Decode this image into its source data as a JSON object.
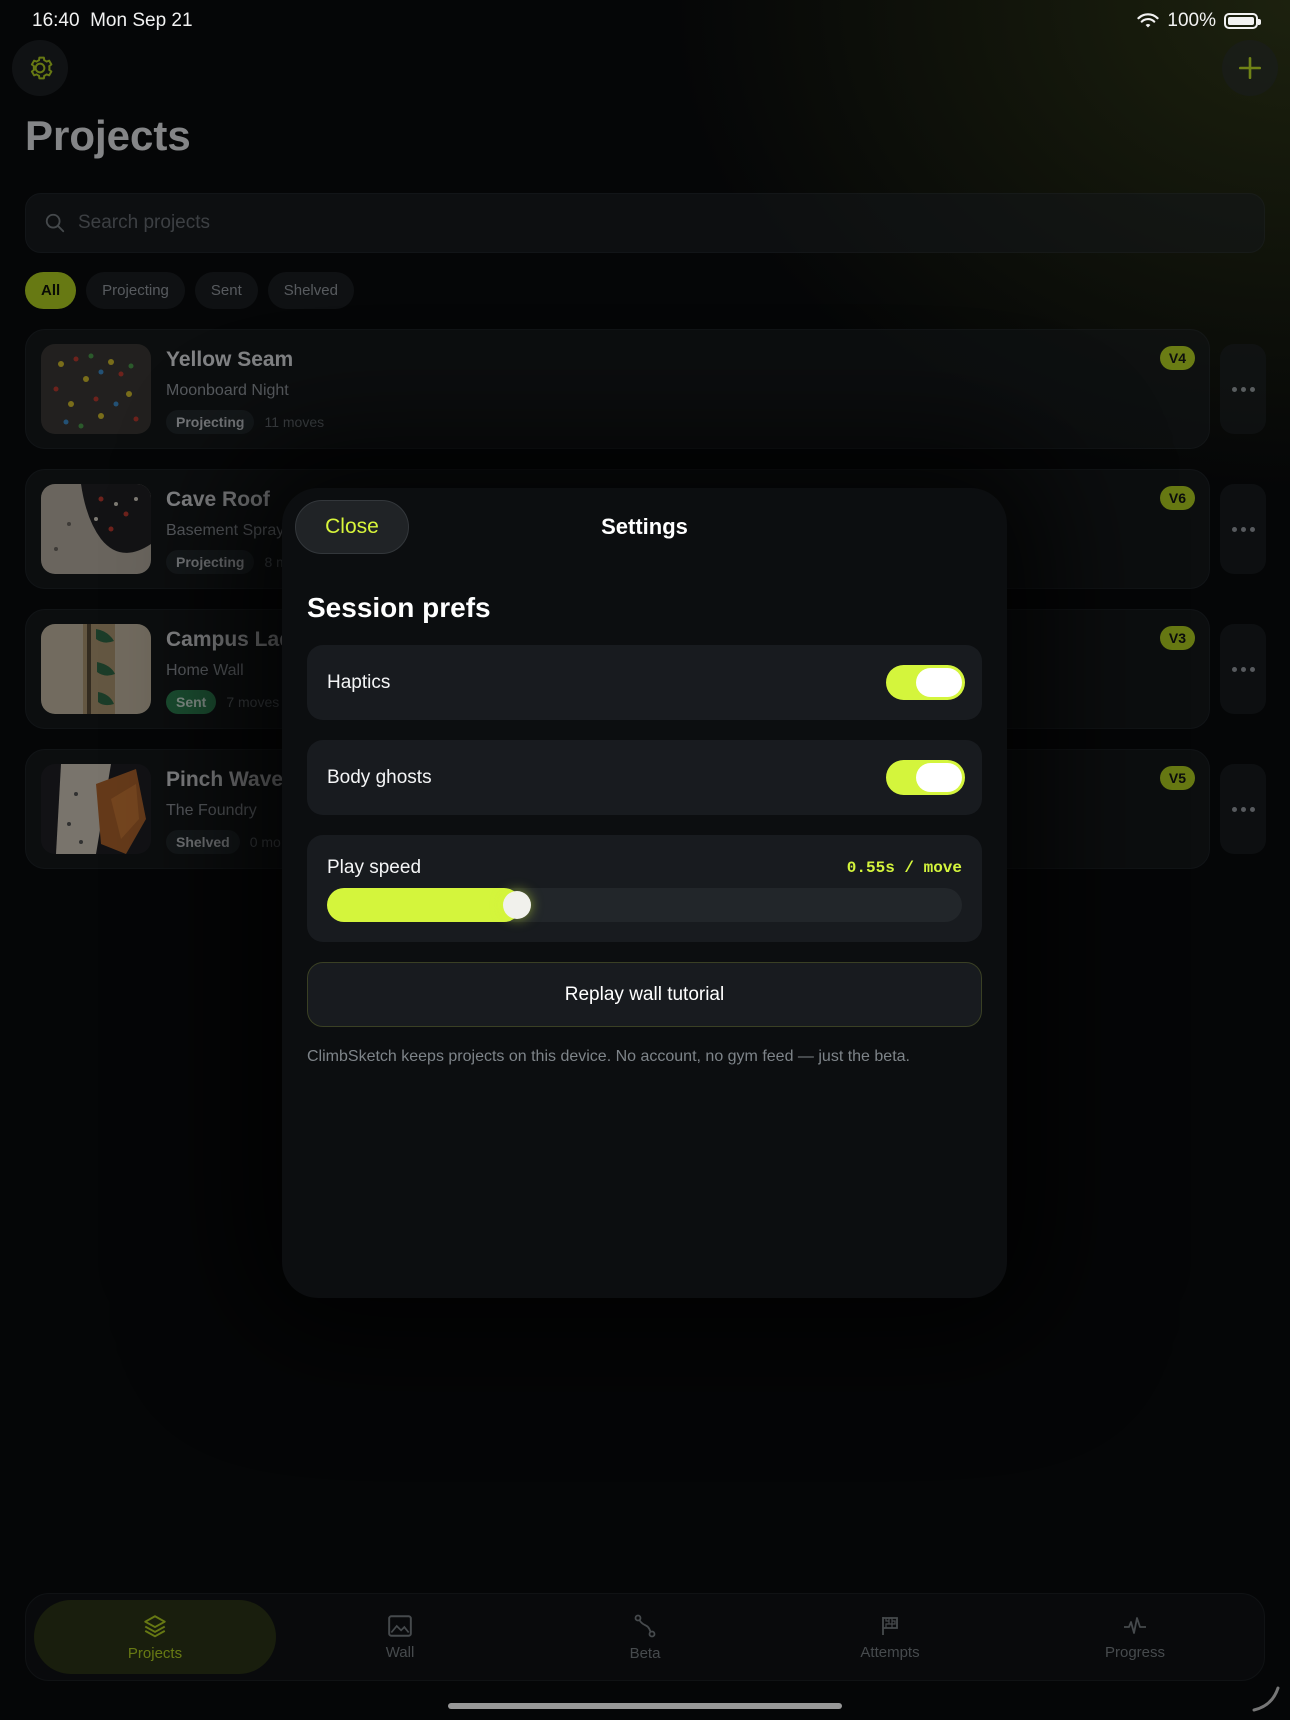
{
  "status_bar": {
    "time": "16:40",
    "date": "Mon Sep 21",
    "battery": "100%"
  },
  "header": {
    "title": "Projects",
    "settings_icon": "gear-icon",
    "add_icon": "plus-icon"
  },
  "search": {
    "placeholder": "Search projects"
  },
  "filters": [
    {
      "label": "All",
      "active": true
    },
    {
      "label": "Projecting",
      "active": false
    },
    {
      "label": "Sent",
      "active": false
    },
    {
      "label": "Shelved",
      "active": false
    }
  ],
  "projects": [
    {
      "name": "Yellow Seam",
      "location": "Moonboard Night",
      "status": "Projecting",
      "moves": "11 moves",
      "grade": "V4"
    },
    {
      "name": "Cave Roof",
      "location": "Basement Spray",
      "status": "Projecting",
      "moves": "8 m",
      "grade": "V6"
    },
    {
      "name": "Campus Lad",
      "location": "Home Wall",
      "status": "Sent",
      "moves": "7 moves",
      "grade": "V3"
    },
    {
      "name": "Pinch Wave",
      "location": "The Foundry",
      "status": "Shelved",
      "moves": "0 mo",
      "grade": "V5"
    }
  ],
  "tabbar": [
    {
      "label": "Projects",
      "icon": "layers-icon",
      "active": true
    },
    {
      "label": "Wall",
      "icon": "image-icon",
      "active": false
    },
    {
      "label": "Beta",
      "icon": "route-icon",
      "active": false
    },
    {
      "label": "Attempts",
      "icon": "flag-icon",
      "active": false
    },
    {
      "label": "Progress",
      "icon": "pulse-icon",
      "active": false
    }
  ],
  "modal": {
    "close_label": "Close",
    "title": "Settings",
    "section_title": "Session prefs",
    "haptics": {
      "label": "Haptics",
      "on": true
    },
    "body_ghosts": {
      "label": "Body ghosts",
      "on": true
    },
    "play_speed": {
      "label": "Play speed",
      "value_text": "0.55s / move",
      "fraction": 0.29
    },
    "replay_label": "Replay wall tutorial",
    "footnote": "ClimbSketch keeps projects on this device. No account, no gym feed — just the beta."
  },
  "colors": {
    "accent": "#d4f53c",
    "accent_dim": "#b8d81e",
    "sent": "#2e8a55",
    "background": "#050607",
    "sheet": "#0c0e10"
  }
}
